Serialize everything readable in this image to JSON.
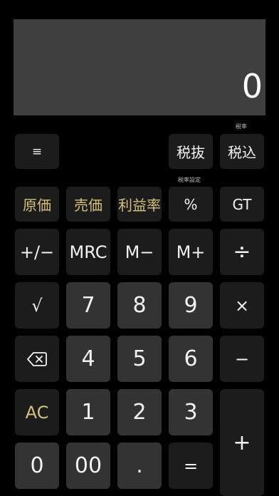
{
  "display": {
    "value": "0"
  },
  "labels": {
    "tax_rate": "税率",
    "tax_rate_setting": "税率設定"
  },
  "buttons": {
    "menu": "≡",
    "tax_exclude": "税抜",
    "tax_include": "税込",
    "cost_price": "原価",
    "sell_price": "売価",
    "profit_rate": "利益率",
    "percent": "%",
    "grand_total": "GT",
    "sign": "+/−",
    "mrc": "MRC",
    "m_minus": "M−",
    "m_plus": "M+",
    "divide": "÷",
    "sqrt": "√",
    "d7": "7",
    "d8": "8",
    "d9": "9",
    "multiply": "×",
    "d4": "4",
    "d5": "5",
    "d6": "6",
    "minus": "−",
    "ac": "AC",
    "d1": "1",
    "d2": "2",
    "d3": "3",
    "plus": "+",
    "d0": "0",
    "d00": "00",
    "dot": ".",
    "equals": "="
  },
  "icons": {
    "backspace": "backspace-icon",
    "menu": "hamburger-menu-icon"
  },
  "colors": {
    "background": "#000000",
    "display": "#3f3f3f",
    "digit_key": "#333333",
    "function_key": "#1c1c1c",
    "accent_text": "#d4c078"
  }
}
